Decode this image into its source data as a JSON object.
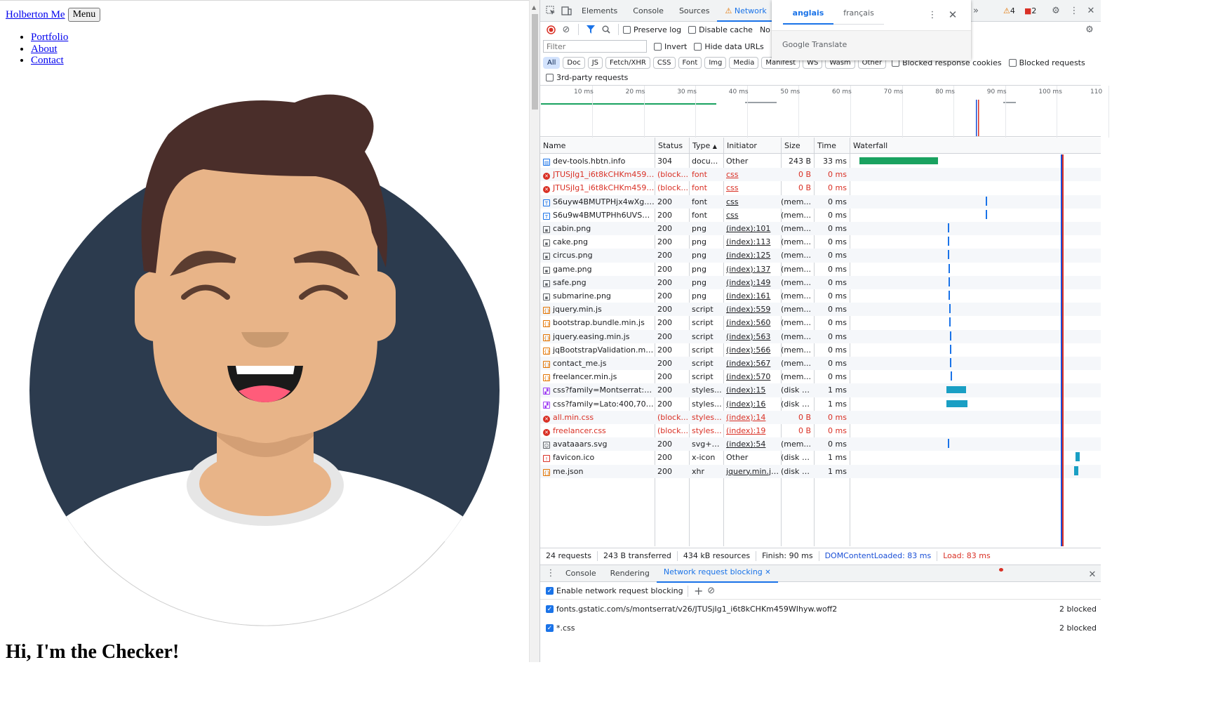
{
  "page": {
    "brand": "Holberton Me",
    "menu_button": "Menu",
    "nav": [
      "Portfolio",
      "About",
      "Contact"
    ],
    "hero_title": "Hi, I'm the Checker!"
  },
  "devtools": {
    "tabs": [
      "Elements",
      "Console",
      "Sources",
      "Network"
    ],
    "active_tab": "Network",
    "warnings_count": "4",
    "errors_count": "2",
    "toolbar": {
      "preserve_log": "Preserve log",
      "disable_cache": "Disable cache",
      "throttle": "No"
    },
    "filter": {
      "placeholder": "Filter",
      "invert": "Invert",
      "hide_data_urls": "Hide data URLs",
      "blocked_response_cookies": "Blocked response cookies",
      "blocked_requests": "Blocked requests",
      "third_party": "3rd-party requests"
    },
    "type_chips": [
      "All",
      "Doc",
      "JS",
      "Fetch/XHR",
      "CSS",
      "Font",
      "Img",
      "Media",
      "Manifest",
      "WS",
      "Wasm",
      "Other"
    ],
    "overview_ticks": [
      "10 ms",
      "20 ms",
      "30 ms",
      "40 ms",
      "50 ms",
      "60 ms",
      "70 ms",
      "80 ms",
      "90 ms",
      "100 ms",
      "110"
    ],
    "columns": [
      "Name",
      "Status",
      "Type",
      "Initiator",
      "Size",
      "Time",
      "Waterfall"
    ],
    "requests": [
      {
        "name": "dev-tools.hbtn.info",
        "status": "304",
        "type": "docu...",
        "initiator": "Other",
        "size": "243 B",
        "time": "33 ms",
        "kind": "doc",
        "error": false
      },
      {
        "name": "JTUSjIg1_i6t8kCHKm459W...",
        "status": "(block...",
        "type": "font",
        "initiator": "css",
        "size": "0 B",
        "time": "0 ms",
        "kind": "blocked",
        "error": true
      },
      {
        "name": "JTUSjIg1_i6t8kCHKm459W...",
        "status": "(block...",
        "type": "font",
        "initiator": "css",
        "size": "0 B",
        "time": "0 ms",
        "kind": "blocked",
        "error": true
      },
      {
        "name": "S6uyw4BMUTPHjx4wXg.w...",
        "status": "200",
        "type": "font",
        "initiator": "css",
        "size": "(mem...",
        "time": "0 ms",
        "kind": "font",
        "error": false
      },
      {
        "name": "S6u9w4BMUTPHh6UVSwiP...",
        "status": "200",
        "type": "font",
        "initiator": "css",
        "size": "(mem...",
        "time": "0 ms",
        "kind": "font",
        "error": false
      },
      {
        "name": "cabin.png",
        "status": "200",
        "type": "png",
        "initiator": "(index):101",
        "size": "(mem...",
        "time": "0 ms",
        "kind": "img",
        "error": false
      },
      {
        "name": "cake.png",
        "status": "200",
        "type": "png",
        "initiator": "(index):113",
        "size": "(mem...",
        "time": "0 ms",
        "kind": "img",
        "error": false
      },
      {
        "name": "circus.png",
        "status": "200",
        "type": "png",
        "initiator": "(index):125",
        "size": "(mem...",
        "time": "0 ms",
        "kind": "img",
        "error": false
      },
      {
        "name": "game.png",
        "status": "200",
        "type": "png",
        "initiator": "(index):137",
        "size": "(mem...",
        "time": "0 ms",
        "kind": "img",
        "error": false
      },
      {
        "name": "safe.png",
        "status": "200",
        "type": "png",
        "initiator": "(index):149",
        "size": "(mem...",
        "time": "0 ms",
        "kind": "img",
        "error": false
      },
      {
        "name": "submarine.png",
        "status": "200",
        "type": "png",
        "initiator": "(index):161",
        "size": "(mem...",
        "time": "0 ms",
        "kind": "img",
        "error": false
      },
      {
        "name": "jquery.min.js",
        "status": "200",
        "type": "script",
        "initiator": "(index):559",
        "size": "(mem...",
        "time": "0 ms",
        "kind": "script",
        "error": false
      },
      {
        "name": "bootstrap.bundle.min.js",
        "status": "200",
        "type": "script",
        "initiator": "(index):560",
        "size": "(mem...",
        "time": "0 ms",
        "kind": "script",
        "error": false
      },
      {
        "name": "jquery.easing.min.js",
        "status": "200",
        "type": "script",
        "initiator": "(index):563",
        "size": "(mem...",
        "time": "0 ms",
        "kind": "script",
        "error": false
      },
      {
        "name": "jqBootstrapValidation.min.js",
        "status": "200",
        "type": "script",
        "initiator": "(index):566",
        "size": "(mem...",
        "time": "0 ms",
        "kind": "script",
        "error": false
      },
      {
        "name": "contact_me.js",
        "status": "200",
        "type": "script",
        "initiator": "(index):567",
        "size": "(mem...",
        "time": "0 ms",
        "kind": "script",
        "error": false
      },
      {
        "name": "freelancer.min.js",
        "status": "200",
        "type": "script",
        "initiator": "(index):570",
        "size": "(mem...",
        "time": "0 ms",
        "kind": "script",
        "error": false
      },
      {
        "name": "css?family=Montserrat:400...",
        "status": "200",
        "type": "styles...",
        "initiator": "(index):15",
        "size": "(disk c...",
        "time": "1 ms",
        "kind": "style",
        "error": false
      },
      {
        "name": "css?family=Lato:400,700,4...",
        "status": "200",
        "type": "styles...",
        "initiator": "(index):16",
        "size": "(disk c...",
        "time": "1 ms",
        "kind": "style",
        "error": false
      },
      {
        "name": "all.min.css",
        "status": "(block...",
        "type": "styles...",
        "initiator": "(index):14",
        "size": "0 B",
        "time": "0 ms",
        "kind": "blocked",
        "error": true
      },
      {
        "name": "freelancer.css",
        "status": "(block...",
        "type": "styles...",
        "initiator": "(index):19",
        "size": "0 B",
        "time": "0 ms",
        "kind": "blocked",
        "error": true
      },
      {
        "name": "avataaars.svg",
        "status": "200",
        "type": "svg+x...",
        "initiator": "(index):54",
        "size": "(mem...",
        "time": "0 ms",
        "kind": "svg",
        "error": false
      },
      {
        "name": "favicon.ico",
        "status": "200",
        "type": "x-icon",
        "initiator": "Other",
        "size": "(disk c...",
        "time": "1 ms",
        "kind": "icon",
        "error": false
      },
      {
        "name": "me.json",
        "status": "200",
        "type": "xhr",
        "initiator": "jquery.min.js:2",
        "size": "(disk c...",
        "time": "1 ms",
        "kind": "xhr",
        "error": false
      }
    ],
    "summary": {
      "requests": "24 requests",
      "transferred": "243 B transferred",
      "resources": "434 kB resources",
      "finish": "Finish: 90 ms",
      "dcl": "DOMContentLoaded: 83 ms",
      "load": "Load: 83 ms"
    },
    "drawer": {
      "tabs": [
        "Console",
        "Rendering",
        "Network request blocking"
      ],
      "active_tab": "Network request blocking",
      "enable_label": "Enable network request blocking",
      "patterns": [
        {
          "pattern": "fonts.gstatic.com/s/montserrat/v26/JTUSjIg1_i6t8kCHKm459WIhyw.woff2",
          "count": "2 blocked"
        },
        {
          "pattern": "*.css",
          "count": "2 blocked"
        }
      ]
    },
    "translate": {
      "tabs": [
        "anglais",
        "français"
      ],
      "active": "anglais",
      "brand": "Google Translate"
    }
  }
}
